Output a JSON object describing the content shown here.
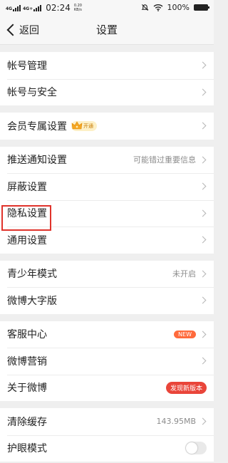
{
  "status_bar": {
    "network1": "4G",
    "network2": "4G+",
    "time": "02:24",
    "speed_value": "0.20",
    "speed_unit": "KB/s",
    "battery": "100%",
    "battery_level": 1.0
  },
  "nav": {
    "back_label": "返回",
    "title": "设置"
  },
  "groups": [
    {
      "items": [
        {
          "label": "帐号管理"
        },
        {
          "label": "帐号与安全"
        }
      ]
    },
    {
      "items": [
        {
          "label": "会员专属设置",
          "badge": "开通"
        }
      ]
    },
    {
      "items": [
        {
          "label": "推送通知设置",
          "value": "可能错过重要信息"
        },
        {
          "label": "屏蔽设置"
        },
        {
          "label": "隐私设置"
        },
        {
          "label": "通用设置"
        }
      ]
    },
    {
      "items": [
        {
          "label": "青少年模式",
          "value": "未开启"
        },
        {
          "label": "微博大字版"
        }
      ]
    },
    {
      "items": [
        {
          "label": "客服中心",
          "pill": "NEW"
        },
        {
          "label": "微博营销"
        },
        {
          "label": "关于微博",
          "pill": "发现新版本"
        }
      ]
    },
    {
      "items": [
        {
          "label": "清除缓存",
          "value": "143.95MB"
        },
        {
          "label": "护眼模式"
        }
      ]
    }
  ],
  "colors": {
    "highlight": "#e0332b",
    "new_pill": "#ff6a3c",
    "version_pill": "#e9453a"
  }
}
